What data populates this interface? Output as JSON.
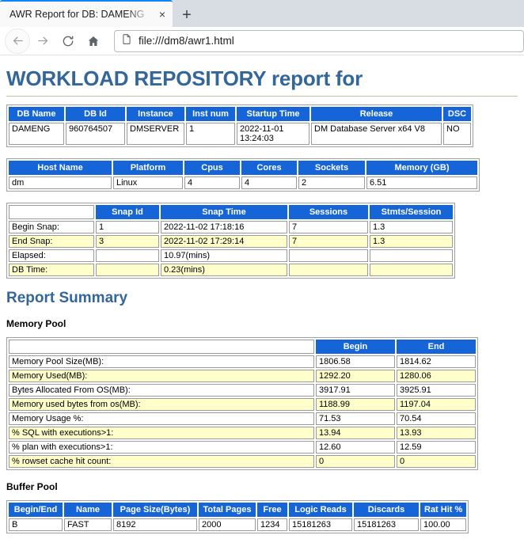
{
  "browser": {
    "tab_title": "AWR Report for DB: DAMENG",
    "tab_close_label": "×",
    "new_tab_label": "+",
    "url": "file:///dm8/awr1.html",
    "back_label": "Back",
    "forward_label": "Forward",
    "reload_label": "Reload",
    "home_label": "Home"
  },
  "page": {
    "title": "WORKLOAD REPOSITORY report for",
    "summary_heading": "Report Summary",
    "memory_pool_heading": "Memory Pool",
    "buffer_pool_heading": "Buffer Pool"
  },
  "db_table": {
    "headers": [
      "DB Name",
      "DB Id",
      "Instance",
      "Inst num",
      "Startup Time",
      "Release",
      "DSC"
    ],
    "rows": [
      [
        "DAMENG",
        "960764507",
        "DMSERVER",
        "1",
        "2022-11-01 13:24:03",
        "DM Database Server x64 V8",
        "NO"
      ]
    ]
  },
  "host_table": {
    "headers": [
      "Host Name",
      "Platform",
      "Cpus",
      "Cores",
      "Sockets",
      "Memory (GB)"
    ],
    "rows": [
      [
        "dm",
        "Linux",
        "4",
        "4",
        "2",
        "6.51"
      ]
    ]
  },
  "snap_table": {
    "headers": [
      "",
      "Snap Id",
      "Snap Time",
      "Sessions",
      "Stmts/Session"
    ],
    "rows": [
      [
        "Begin Snap:",
        "1",
        "2022-11-02 17:18:16",
        "7",
        "1.3"
      ],
      [
        "End Snap:",
        "3",
        "2022-11-02 17:29:14",
        "7",
        "1.3"
      ],
      [
        "Elapsed:",
        "",
        "10.97(mins)",
        "",
        ""
      ],
      [
        "DB Time:",
        "",
        "0.23(mins)",
        "",
        ""
      ]
    ]
  },
  "memory_pool_table": {
    "headers": [
      "",
      "Begin",
      "End"
    ],
    "rows": [
      [
        "Memory Pool Size(MB):",
        "1806.58",
        "1814.62"
      ],
      [
        "Memory Used(MB):",
        "1292.20",
        "1280.06"
      ],
      [
        "Bytes Allocated From OS(MB):",
        "3917.91",
        "3925.91"
      ],
      [
        "Memory used bytes from os(MB):",
        "1188.99",
        "1197.04"
      ],
      [
        "Memory Usage %:",
        "71.53",
        "70.54"
      ],
      [
        "% SQL with executions>1:",
        "13.94",
        "13.93"
      ],
      [
        "% plan with executions>1:",
        "12.60",
        "12.59"
      ],
      [
        "% rowset cache hit count:",
        "0",
        "0"
      ]
    ]
  },
  "buffer_pool_table": {
    "headers": [
      "Begin/End",
      "Name",
      "Page Size(Bytes)",
      "Total Pages",
      "Free",
      "Logic Reads",
      "Discards",
      "Rat Hit %"
    ],
    "rows": [
      [
        "B",
        "FAST",
        "8192",
        "2000",
        "1234",
        "15181263   ",
        "15181263   ",
        "100.00"
      ]
    ]
  },
  "colors": {
    "header_blue": "#1565d8",
    "heading_blue": "#336699",
    "alt_row": "#ffffcc",
    "rule": "#c9c39a"
  }
}
